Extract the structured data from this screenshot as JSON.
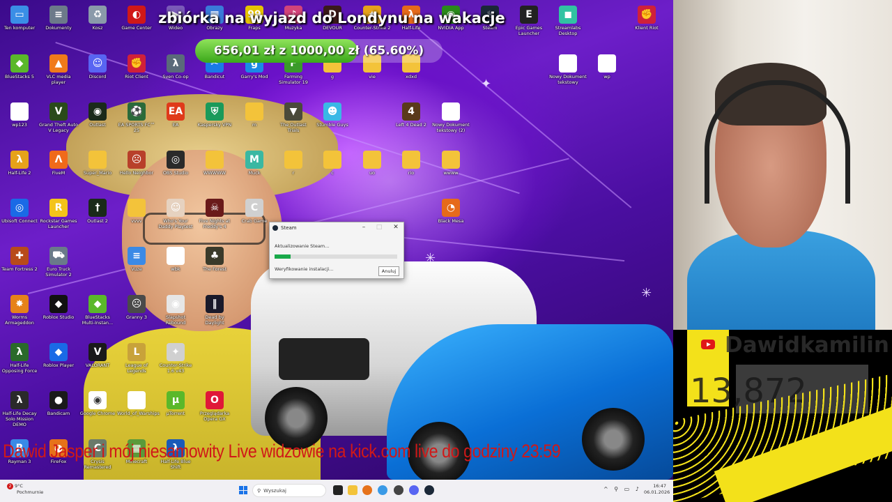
{
  "overlay": {
    "title": "zbiórka na wyjazd do Londynu na wakacje",
    "goal_text": "656,01 zł  z  1000,00 zł  (65.60%)",
    "goal_progress": 0.656,
    "ticker": "Dawid Jasper i mój niesamowity Live widzowie na     kick.com  live do godziny 23:59"
  },
  "desktop_icons": [
    {
      "label": "Ten komputer",
      "icon": "computer-icon",
      "color": "#3a8ee6",
      "glyph": "▭"
    },
    {
      "label": "Dokumenty",
      "icon": "documents-icon",
      "color": "#6c7a8a",
      "glyph": "≡"
    },
    {
      "label": "Kosz",
      "icon": "recycle-bin-icon",
      "color": "#8a9aaa",
      "glyph": "♻"
    },
    {
      "label": "Game Center",
      "icon": "game-center-icon",
      "color": "#d01818",
      "glyph": "◐"
    },
    {
      "label": "Wideo",
      "icon": "video-folder-icon",
      "color": "#7a5ab8",
      "glyph": "▶"
    },
    {
      "label": "Obrazy",
      "icon": "pictures-folder-icon",
      "color": "#3a7ad8",
      "glyph": "▦"
    },
    {
      "label": "Fraps",
      "icon": "fraps-icon",
      "color": "#e5c300",
      "glyph": "99"
    },
    {
      "label": "Muzyka",
      "icon": "music-folder-icon",
      "color": "#d2447a",
      "glyph": "♪"
    },
    {
      "label": "DEVOUR",
      "icon": "devour-icon",
      "color": "#3a1a1a",
      "glyph": "D"
    },
    {
      "label": "Counter-Strike 2",
      "icon": "cs2-icon",
      "color": "#e6a21a",
      "glyph": "✦"
    },
    {
      "label": "Half-Life",
      "icon": "half-life-icon",
      "color": "#e56a1a",
      "glyph": "λ"
    },
    {
      "label": "NVIDIA App",
      "icon": "nvidia-icon",
      "color": "#2a8a1a",
      "glyph": "◉"
    },
    {
      "label": "Steam",
      "icon": "steam-icon",
      "color": "#1b2838",
      "glyph": "♨"
    },
    {
      "label": "Epic Games Launcher",
      "icon": "epic-games-icon",
      "color": "#222222",
      "glyph": "E"
    },
    {
      "label": "Streamlabs Desktop",
      "icon": "streamlabs-icon",
      "color": "#31c3a2",
      "glyph": "◼"
    },
    {
      "label": "Klient Riot",
      "icon": "riot-client-icon",
      "color": "#d0203a",
      "glyph": "✊"
    },
    {
      "label": "BlueStacks 5",
      "icon": "bluestacks-icon",
      "color": "#5ab82a",
      "glyph": "◆"
    },
    {
      "label": "VLC media player",
      "icon": "vlc-icon",
      "color": "#f07a1a",
      "glyph": "▲"
    },
    {
      "label": "Discord",
      "icon": "discord-icon",
      "color": "#5865f2",
      "glyph": "☺"
    },
    {
      "label": "Riot Client",
      "icon": "riot-client-icon",
      "color": "#d0203a",
      "glyph": "✊"
    },
    {
      "label": "Sven Co-op",
      "icon": "sven-coop-icon",
      "color": "#5a6a7a",
      "glyph": "λ"
    },
    {
      "label": "Bandicut",
      "icon": "bandicut-icon",
      "color": "#1a7ae6",
      "glyph": "✂"
    },
    {
      "label": "Garry's Mod",
      "icon": "garrys-mod-icon",
      "color": "#1a8ae6",
      "glyph": "g"
    },
    {
      "label": "Farming Simulator 19",
      "icon": "farming-sim-icon",
      "color": "#3a9a2a",
      "glyph": "F"
    },
    {
      "label": "g",
      "icon": "folder-icon",
      "color": "#f3c33a",
      "glyph": ""
    },
    {
      "label": "vie",
      "icon": "folder-icon",
      "color": "#f3c33a",
      "glyph": ""
    },
    {
      "label": "xdxd",
      "icon": "folder-icon",
      "color": "#f3c33a",
      "glyph": ""
    },
    {
      "label": "Nowy Dokument tekstowy",
      "icon": "text-file-icon",
      "color": "#ffffff",
      "glyph": ""
    },
    {
      "label": "wp",
      "icon": "text-file-icon",
      "color": "#ffffff",
      "glyph": ""
    },
    {
      "label": "wp123",
      "icon": "text-file-icon",
      "color": "#ffffff",
      "glyph": ""
    },
    {
      "label": "Grand Theft Auto V Legacy",
      "icon": "gta5-icon",
      "color": "#2a4a1a",
      "glyph": "V"
    },
    {
      "label": "Outlast",
      "icon": "outlast-icon",
      "color": "#1a2a1a",
      "glyph": "◉"
    },
    {
      "label": "EA SPORTS FC™ 25",
      "icon": "ea-fc-icon",
      "color": "#2a6a3a",
      "glyph": "⚽"
    },
    {
      "label": "EA",
      "icon": "ea-icon",
      "color": "#e03a1a",
      "glyph": "EA"
    },
    {
      "label": "Kaspersky VPN",
      "icon": "kaspersky-vpn-icon",
      "color": "#1a9a5a",
      "glyph": "⛨"
    },
    {
      "label": "m",
      "icon": "folder-icon",
      "color": "#f3c33a",
      "glyph": ""
    },
    {
      "label": "The Outlast Trials",
      "icon": "outlast-trials-icon",
      "color": "#4a4a3a",
      "glyph": "▼"
    },
    {
      "label": "Stumble Guys",
      "icon": "stumble-guys-icon",
      "color": "#3ab8e6",
      "glyph": "☻"
    },
    {
      "label": "Left 4 Dead 2",
      "icon": "left4dead2-icon",
      "color": "#5a3a1a",
      "glyph": "4"
    },
    {
      "label": "Nowy Dokument tekstowy (2)",
      "icon": "text-file-icon",
      "color": "#ffffff",
      "glyph": ""
    },
    {
      "label": "Half-Life 2",
      "icon": "half-life2-icon",
      "color": "#e6a21a",
      "glyph": "λ"
    },
    {
      "label": "FiveM",
      "icon": "fivem-icon",
      "color": "#f06a1a",
      "glyph": "Λ"
    },
    {
      "label": "Super_Mario",
      "icon": "folder-icon",
      "color": "#f3c33a",
      "glyph": ""
    },
    {
      "label": "Hello Neighbor",
      "icon": "hello-neighbor-icon",
      "color": "#b8402a",
      "glyph": "☹"
    },
    {
      "label": "OBS Studio",
      "icon": "obs-icon",
      "color": "#2a2a2a",
      "glyph": "◎"
    },
    {
      "label": "WWWWW",
      "icon": "folder-icon",
      "color": "#f3c33a",
      "glyph": ""
    },
    {
      "label": "Muck",
      "icon": "muck-icon",
      "color": "#3ab8a2",
      "glyph": "M"
    },
    {
      "label": "r",
      "icon": "folder-icon",
      "color": "#f3c33a",
      "glyph": ""
    },
    {
      "label": "c",
      "icon": "folder-icon",
      "color": "#f3c33a",
      "glyph": ""
    },
    {
      "label": "uo",
      "icon": "folder-icon",
      "color": "#f3c33a",
      "glyph": ""
    },
    {
      "label": "rio",
      "icon": "folder-icon",
      "color": "#f3c33a",
      "glyph": ""
    },
    {
      "label": "wwww",
      "icon": "folder-icon",
      "color": "#f3c33a",
      "glyph": ""
    },
    {
      "label": "Ubisoft Connect",
      "icon": "ubisoft-icon",
      "color": "#1a6ae6",
      "glyph": "◎"
    },
    {
      "label": "Rockstar Games Launcher",
      "icon": "rockstar-icon",
      "color": "#f3c31a",
      "glyph": "R"
    },
    {
      "label": "Outlast 2",
      "icon": "outlast2-icon",
      "color": "#1a2a1a",
      "glyph": "†"
    },
    {
      "label": "vvvv",
      "icon": "folder-icon",
      "color": "#f3c33a",
      "glyph": ""
    },
    {
      "label": "Who's Your Daddy Playtest",
      "icon": "whos-your-daddy-icon",
      "color": "#e6d2c0",
      "glyph": "☺"
    },
    {
      "label": "Five Nights at Freddy's 4",
      "icon": "fnaf4-icon",
      "color": "#6a1a1a",
      "glyph": "☠"
    },
    {
      "label": "Crab Game",
      "icon": "crab-game-icon",
      "color": "#d0d0d0",
      "glyph": "C"
    },
    {
      "label": "Black Mesa",
      "icon": "black-mesa-icon",
      "color": "#e66a1a",
      "glyph": "◔"
    },
    {
      "label": "Team Fortress 2",
      "icon": "tf2-icon",
      "color": "#b84a1a",
      "glyph": "✚"
    },
    {
      "label": "Euro Truck Simulator 2",
      "icon": "euro-truck-icon",
      "color": "#6a7a8a",
      "glyph": "⛟"
    },
    {
      "label": "Vuze",
      "icon": "vuze-icon",
      "color": "#3a8ae6",
      "glyph": "≡"
    },
    {
      "label": "wbk",
      "icon": "text-file-icon",
      "color": "#ffffff",
      "glyph": ""
    },
    {
      "label": "The Forest",
      "icon": "the-forest-icon",
      "color": "#3a3a2a",
      "glyph": "♣"
    },
    {
      "label": "Worms Armageddon",
      "icon": "worms-icon",
      "color": "#e6821a",
      "glyph": "✸"
    },
    {
      "label": "Roblox Studio",
      "icon": "roblox-studio-icon",
      "color": "#111111",
      "glyph": "◆"
    },
    {
      "label": "BlueStacks Multi-Instan...",
      "icon": "bluestacks-multi-icon",
      "color": "#5ab82a",
      "glyph": "◆"
    },
    {
      "label": "Granny 3",
      "icon": "granny3-icon",
      "color": "#4a4a4a",
      "glyph": "☹"
    },
    {
      "label": "Slapshot Rebound",
      "icon": "slapshot-icon",
      "color": "#e6e6e6",
      "glyph": "◉"
    },
    {
      "label": "Dead by Daylight",
      "icon": "dead-by-daylight-icon",
      "color": "#1a1a2a",
      "glyph": "‖"
    },
    {
      "label": "Half-Life Opposing Force",
      "icon": "opposing-force-icon",
      "color": "#2a6a2a",
      "glyph": "λ"
    },
    {
      "label": "Roblox Player",
      "icon": "roblox-player-icon",
      "color": "#1a6ae6",
      "glyph": "◆"
    },
    {
      "label": "VALORANT",
      "icon": "valorant-icon",
      "color": "#1a1a1a",
      "glyph": "V"
    },
    {
      "label": "League of Legends",
      "icon": "lol-icon",
      "color": "#c8a23a",
      "glyph": "L"
    },
    {
      "label": "Counter-Strike 1.6 v43",
      "icon": "cs16-icon",
      "color": "#d0d0d0",
      "glyph": "✦"
    },
    {
      "label": "Half-Life Decay Solo Mission DEMO",
      "icon": "decay-icon",
      "color": "#2a2a2a",
      "glyph": "λ"
    },
    {
      "label": "Bandicam",
      "icon": "bandicam-icon",
      "color": "#1a1a1a",
      "glyph": "●"
    },
    {
      "label": "Google Chrome",
      "icon": "chrome-icon",
      "color": "#ffffff",
      "glyph": "◉"
    },
    {
      "label": "World_of_Warships",
      "icon": "text-file-icon",
      "color": "#ffffff",
      "glyph": ""
    },
    {
      "label": "µTorrent",
      "icon": "utorrent-icon",
      "color": "#5ab82a",
      "glyph": "µ"
    },
    {
      "label": "Przeglądarka Opera GX",
      "icon": "opera-gx-icon",
      "color": "#e01838",
      "glyph": "O"
    },
    {
      "label": "Rayman 3",
      "icon": "rayman-icon",
      "color": "#3a8ae6",
      "glyph": "R"
    },
    {
      "label": "FireFox",
      "icon": "firefox-icon",
      "color": "#e6721a",
      "glyph": "◕"
    },
    {
      "label": "Crysis Remastered",
      "icon": "crysis-icon",
      "color": "#6a7a6a",
      "glyph": "C"
    },
    {
      "label": "Minecraft",
      "icon": "minecraft-icon",
      "color": "#5a9a3a",
      "glyph": "▦"
    },
    {
      "label": "Half-Life Blue Shift",
      "icon": "blue-shift-icon",
      "color": "#1a5ab8",
      "glyph": "λ"
    }
  ],
  "steam_dialog": {
    "title": "Steam",
    "message": "Aktualizowanie Steam...",
    "status": "Weryfikowanie instalacji...",
    "progress": 0.13,
    "cancel_label": "Anuluj",
    "minimize": "–",
    "maximize": "□",
    "close": "✕"
  },
  "taskbar": {
    "temp": "9°C",
    "weather": "Pochmurnie",
    "weather_badge": "2",
    "search_placeholder": "Wyszukaj",
    "time": "16:47",
    "date": "06.01.2026"
  },
  "alert": {
    "channel": "Dawidkamilin",
    "count": "13,872"
  }
}
